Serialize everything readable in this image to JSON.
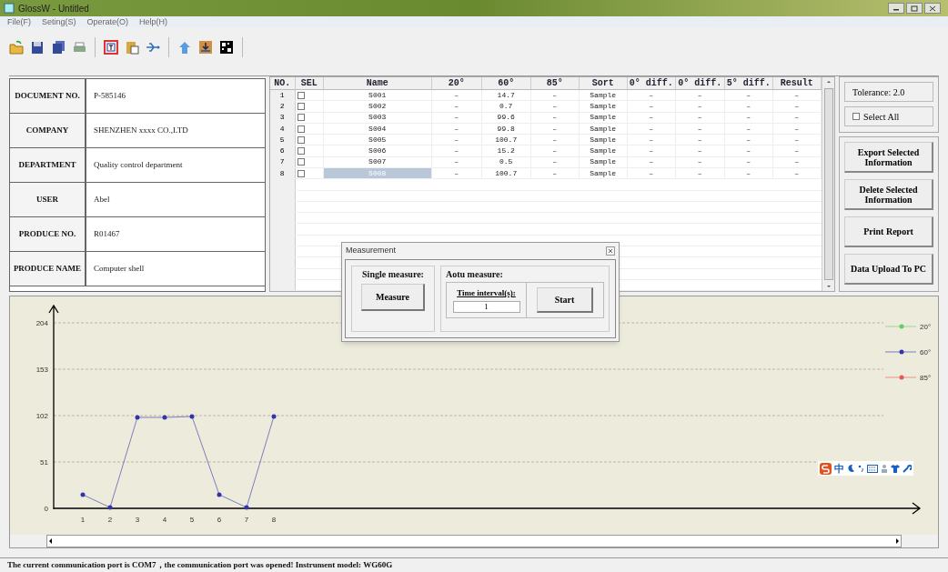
{
  "window": {
    "title": "GlossW - Untitled"
  },
  "menu": [
    "File(F)",
    "Seting(S)",
    "Operate(O)",
    "Help(H)"
  ],
  "info_table": [
    {
      "label": "DOCUMENT NO.",
      "value": "P-585146"
    },
    {
      "label": "COMPANY",
      "value": "SHENZHEN xxxx CO.,LTD"
    },
    {
      "label": "DEPARTMENT",
      "value": "Quality control department"
    },
    {
      "label": "USER",
      "value": "Abel"
    },
    {
      "label": "PRODUCE NO.",
      "value": "R01467"
    },
    {
      "label": "PRODUCE NAME",
      "value": "Computer shell"
    }
  ],
  "grid": {
    "columns": [
      "NO.",
      "SEL",
      "Name",
      "20°",
      "60°",
      "85°",
      "Sort",
      "0° diff.",
      "0° diff.",
      "5° diff.",
      "Result"
    ],
    "rows": [
      {
        "checked": false,
        "selected": false,
        "cells": [
          "1",
          "",
          "S001",
          "–",
          "14.7",
          "–",
          "Sample",
          "–",
          "–",
          "–",
          "–"
        ]
      },
      {
        "checked": false,
        "selected": false,
        "cells": [
          "2",
          "",
          "S002",
          "–",
          "0.7",
          "–",
          "Sample",
          "–",
          "–",
          "–",
          "–"
        ]
      },
      {
        "checked": false,
        "selected": false,
        "cells": [
          "3",
          "",
          "S003",
          "–",
          "99.6",
          "–",
          "Sample",
          "–",
          "–",
          "–",
          "–"
        ]
      },
      {
        "checked": false,
        "selected": false,
        "cells": [
          "4",
          "",
          "S004",
          "–",
          "99.8",
          "–",
          "Sample",
          "–",
          "–",
          "–",
          "–"
        ]
      },
      {
        "checked": false,
        "selected": false,
        "cells": [
          "5",
          "",
          "S005",
          "–",
          "100.7",
          "–",
          "Sample",
          "–",
          "–",
          "–",
          "–"
        ]
      },
      {
        "checked": false,
        "selected": false,
        "cells": [
          "6",
          "",
          "S006",
          "–",
          "15.2",
          "–",
          "Sample",
          "–",
          "–",
          "–",
          "–"
        ]
      },
      {
        "checked": false,
        "selected": false,
        "cells": [
          "7",
          "",
          "S007",
          "–",
          "0.5",
          "–",
          "Sample",
          "–",
          "–",
          "–",
          "–"
        ]
      },
      {
        "checked": false,
        "selected": true,
        "cells": [
          "8",
          "",
          "S008",
          "–",
          "100.7",
          "–",
          "Sample",
          "–",
          "–",
          "–",
          "–"
        ]
      }
    ]
  },
  "right_panel": {
    "tolerance": "Tolerance: 2.0",
    "select_all": {
      "label": "Select All",
      "checked": false
    },
    "buttons": [
      "Export Selected Information",
      "Delete Selected Information",
      "Print Report",
      "Data Upload To PC"
    ]
  },
  "dialog": {
    "title": "Measurement",
    "single_label": "Single measure:",
    "measure_button": "Measure",
    "auto_label": "Aotu measure:",
    "interval_label": "Time interval(s):",
    "interval_value": "1",
    "start_button": "Start"
  },
  "chart": {
    "chart_data": {
      "type": "line",
      "categories": [
        "1",
        "2",
        "3",
        "4",
        "5",
        "6",
        "7",
        "8"
      ],
      "yticks": [
        0,
        51,
        102,
        153,
        204
      ],
      "ylim": [
        0,
        204
      ],
      "grid": true,
      "series": [
        {
          "name": "20°",
          "color": "#66cc66",
          "values": [
            null,
            null,
            null,
            null,
            null,
            null,
            null,
            null
          ]
        },
        {
          "name": "60°",
          "color": "#3333aa",
          "values": [
            15,
            1,
            100,
            100,
            101,
            15,
            1,
            101
          ]
        },
        {
          "name": "85°",
          "color": "#ee5555",
          "values": [
            null,
            null,
            null,
            null,
            null,
            null,
            null,
            null
          ]
        }
      ]
    }
  },
  "ime_toolbar": {
    "label": "中"
  },
  "status_bar": "The current communication port is COM7，the communication port was opened! Instrument model: WG60G"
}
